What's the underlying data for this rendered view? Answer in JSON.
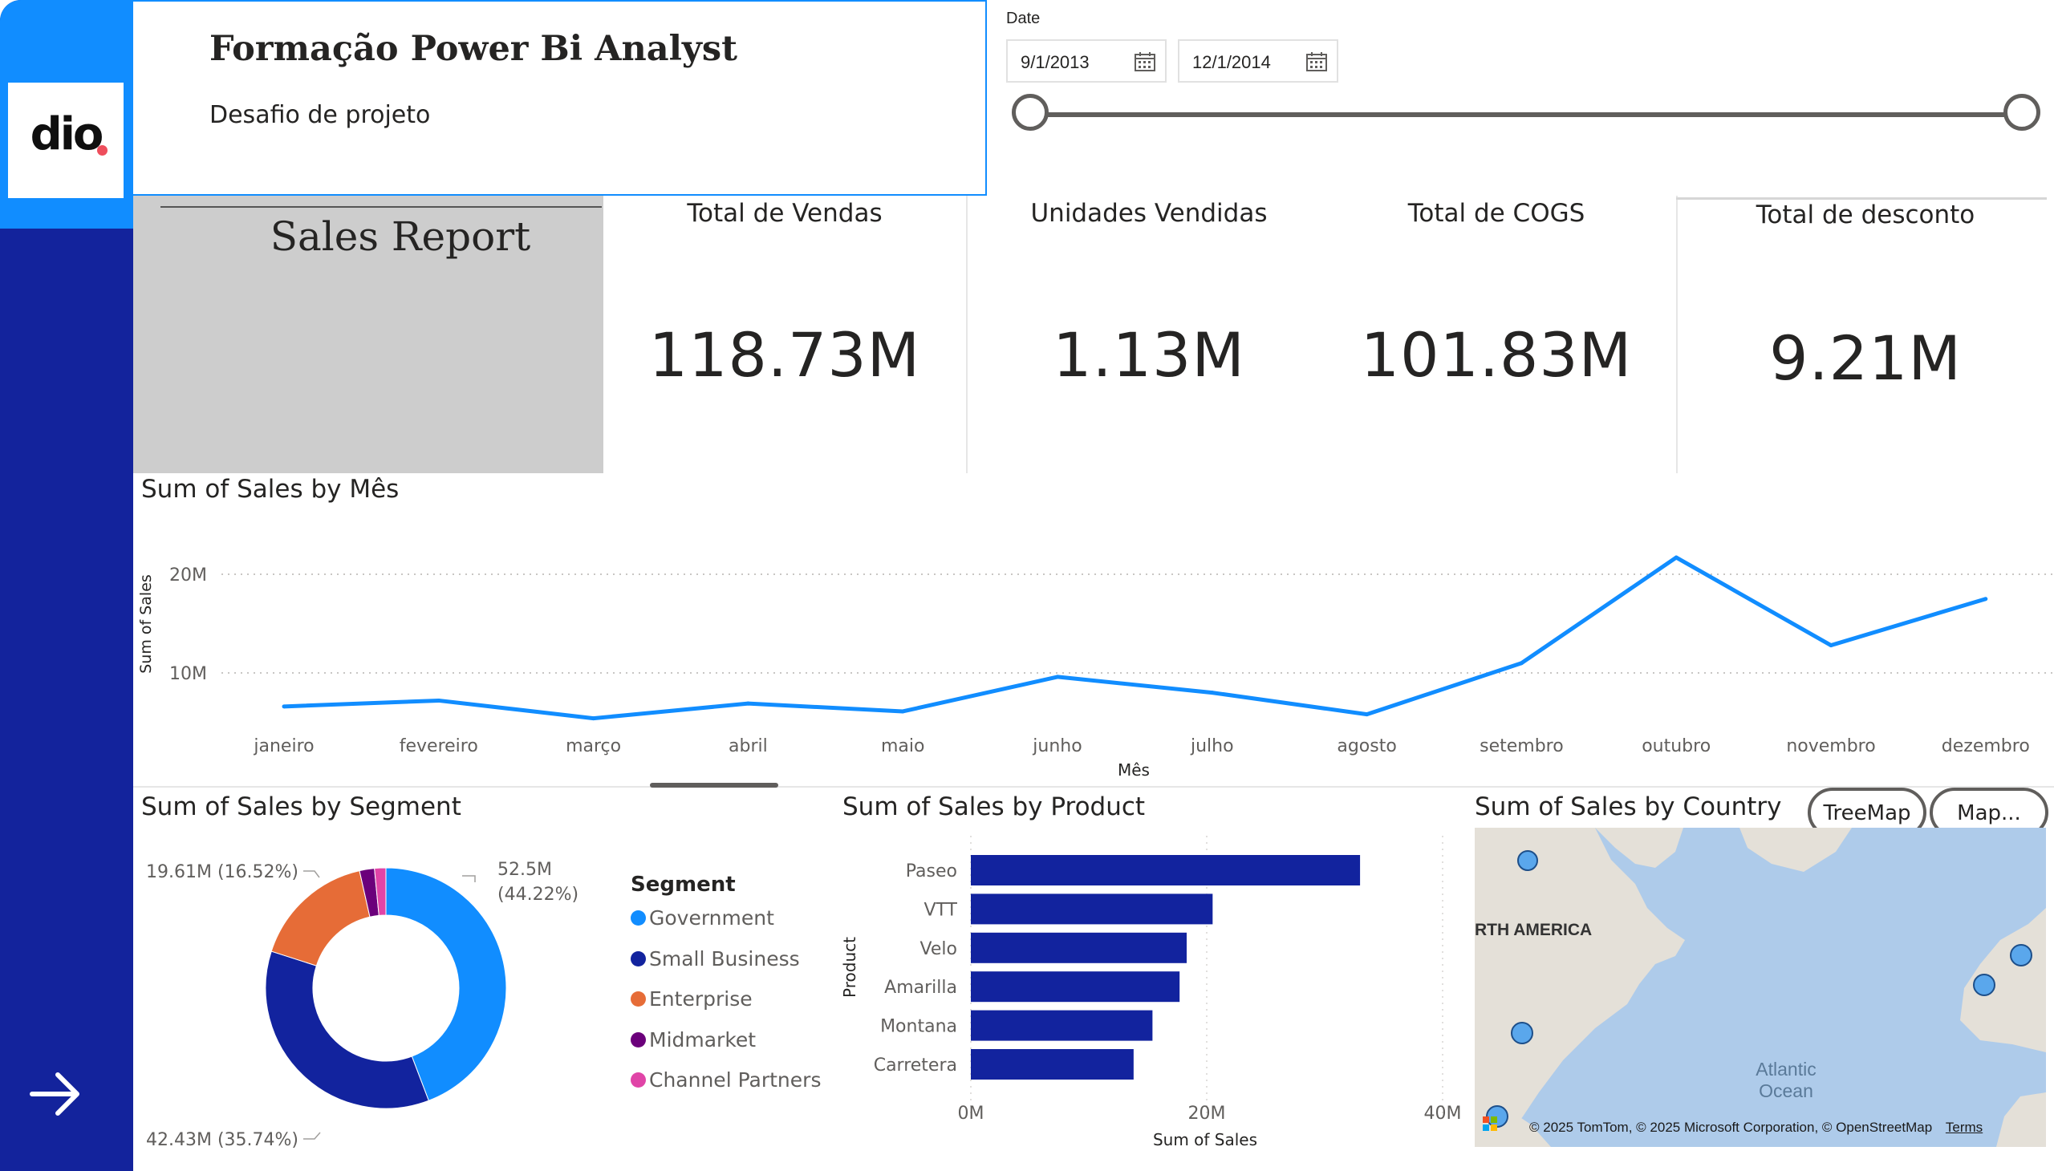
{
  "header": {
    "logo_text": "dio",
    "title": "Formação Power Bi Analyst",
    "subtitle": "Desafio de projeto"
  },
  "date_slicer": {
    "label": "Date",
    "start": "9/1/2013",
    "end": "12/1/2014"
  },
  "report_title": "Sales Report",
  "kpis": [
    {
      "label": "Total de Vendas",
      "value": "118.73M"
    },
    {
      "label": "Unidades Vendidas",
      "value": "1.13M"
    },
    {
      "label": "Total de COGS",
      "value": "101.83M"
    },
    {
      "label": "Total de desconto",
      "value": "9.21M"
    }
  ],
  "colors": {
    "primary_blue": "#118dff",
    "navy": "#12239e",
    "orange": "#e66c37",
    "purple": "#6b007b",
    "pink": "#e044a7",
    "rail": "#13239c"
  },
  "chart_data": [
    {
      "type": "line",
      "title": "Sum of Sales by Mês",
      "xlabel": "Mês",
      "ylabel": "Sum of Sales",
      "categories": [
        "janeiro",
        "fevereiro",
        "março",
        "abril",
        "maio",
        "junho",
        "julho",
        "agosto",
        "setembro",
        "outubro",
        "novembro",
        "dezembro"
      ],
      "values": [
        6.6,
        7.2,
        5.4,
        6.9,
        6.1,
        9.6,
        8.0,
        5.8,
        11.0,
        21.7,
        12.8,
        17.5
      ],
      "unit": "M",
      "ylim": [
        0,
        25
      ],
      "yticks": [
        {
          "v": 10,
          "label": "10M"
        },
        {
          "v": 20,
          "label": "20M"
        }
      ],
      "grid": true,
      "color": "#118dff"
    },
    {
      "type": "pie",
      "title": "Sum of Sales by Segment",
      "legend_title": "Segment",
      "legend_position": "right",
      "slices": [
        {
          "name": "Government",
          "value": 52.5,
          "label": "52.5M",
          "pct": "(44.22%)",
          "color": "#118dff"
        },
        {
          "name": "Small Business",
          "value": 42.43,
          "label": "42.43M (35.74%)",
          "color": "#12239e"
        },
        {
          "name": "Enterprise",
          "value": 19.61,
          "label": "19.61M (16.52%)",
          "color": "#e66c37"
        },
        {
          "name": "Midmarket",
          "value": 2.38,
          "color": "#6b007b"
        },
        {
          "name": "Channel Partners",
          "value": 1.81,
          "color": "#e044a7"
        }
      ]
    },
    {
      "type": "bar",
      "orientation": "horizontal",
      "title": "Sum of Sales by Product",
      "xlabel": "Sum of Sales",
      "ylabel": "Product",
      "categories": [
        "Paseo",
        "VTT",
        "Velo",
        "Amarilla",
        "Montana",
        "Carretera"
      ],
      "values": [
        33.0,
        20.5,
        18.3,
        17.7,
        15.4,
        13.8
      ],
      "unit": "M",
      "xlim": [
        0,
        40
      ],
      "xticks": [
        {
          "v": 0,
          "label": "0M"
        },
        {
          "v": 20,
          "label": "20M"
        },
        {
          "v": 40,
          "label": "40M"
        }
      ],
      "color": "#12239e"
    }
  ],
  "country_map": {
    "title": "Sum of Sales by Country",
    "buttons": [
      "TreeMap",
      "Map..."
    ],
    "region_label": "RTH AMERICA",
    "ocean_label_1": "Atlantic",
    "ocean_label_2": "Ocean",
    "credit": "© 2025 TomTom, © 2025 Microsoft Corporation, © OpenStreetMap",
    "terms": "Terms"
  }
}
